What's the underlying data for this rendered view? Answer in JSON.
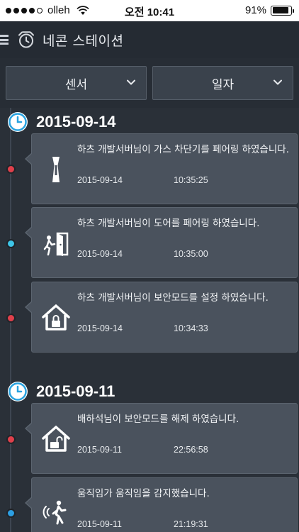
{
  "status_bar": {
    "carrier": "olleh",
    "time": "오전 10:41",
    "battery": "91%",
    "battery_level": 0.91,
    "signal_bars_filled": 4,
    "signal_bars_total": 5
  },
  "header": {
    "title": "네콘 스테이션",
    "icons": [
      "menu-icon",
      "alarm-clock-icon"
    ]
  },
  "filters": {
    "sensor_label": "센서",
    "date_label": "일자"
  },
  "colors": {
    "accent_blue": "#2aa3e0",
    "dot_red": "#e0404b",
    "dot_cyan": "#3ec5e8",
    "dot_blue": "#2d9fe3"
  },
  "timeline": [
    {
      "date": "2015-09-14",
      "events": [
        {
          "message": "하츠 개발서버님이 가스 차단기를 페어링 하였습니다.",
          "date": "2015-09-14",
          "time": "10:35:25",
          "icon": "gas-valve-icon",
          "status": "red"
        },
        {
          "message": "하츠 개발서버님이 도어를 페어링 하였습니다.",
          "date": "2015-09-14",
          "time": "10:35:00",
          "icon": "door-icon",
          "status": "cyan"
        },
        {
          "message": "하츠 개발서버님이 보안모드를 설정 하였습니다.",
          "date": "2015-09-14",
          "time": "10:34:33",
          "icon": "home-lock-icon",
          "status": "red"
        }
      ]
    },
    {
      "date": "2015-09-11",
      "events": [
        {
          "message": "배하석님이 보안모드를 해제 하였습니다.",
          "date": "2015-09-11",
          "time": "22:56:58",
          "icon": "home-unlock-icon",
          "status": "red"
        },
        {
          "message": "움직임가 움직임을 감지했습니다.",
          "date": "2015-09-11",
          "time": "21:19:31",
          "icon": "motion-sensor-icon",
          "status": "blue"
        }
      ]
    }
  ]
}
